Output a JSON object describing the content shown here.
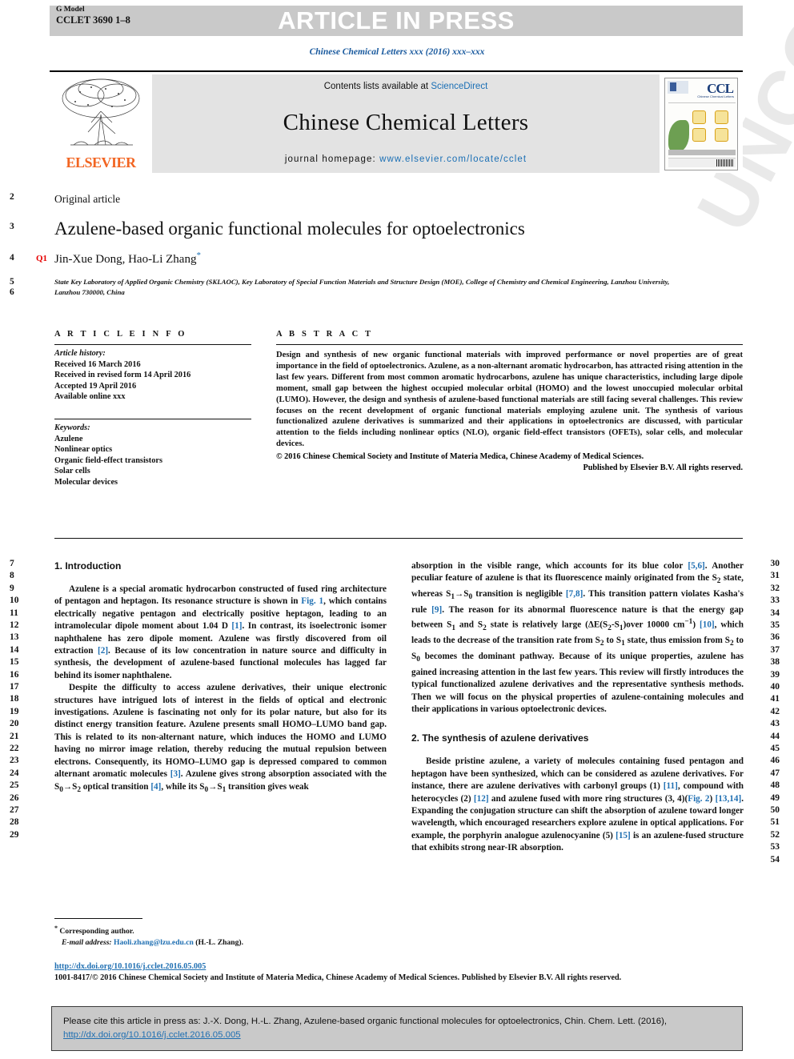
{
  "header": {
    "g_model": "G Model",
    "article_code": "CCLET 3690 1–8",
    "article_in_press": "ARTICLE IN PRESS",
    "journal_ref": "Chinese Chemical Letters xxx (2016) xxx–xxx"
  },
  "masthead": {
    "contents_prefix": "Contents lists available at ",
    "contents_link": "ScienceDirect",
    "journal_title": "Chinese Chemical Letters",
    "homepage_label": "journal homepage: ",
    "homepage_url": "www.elsevier.com/locate/cclet",
    "publisher": "ELSEVIER",
    "cover_logo": "CCL",
    "cover_subtitle": "Chinese Chemical Letters"
  },
  "article": {
    "type_label": "Original article",
    "title": "Azulene-based organic functional molecules for optoelectronics",
    "query_marker": "Q1",
    "authors": "Jin-Xue Dong, Hao-Li Zhang",
    "corresponding_mark": "*",
    "affiliation": "State Key Laboratory of Applied Organic Chemistry (SKLAOC), Key Laboratory of Special Function Materials and Structure Design (MOE), College of Chemistry and Chemical Engineering, Lanzhou University, Lanzhou 730000, China"
  },
  "info": {
    "heading": "A R T I C L E  I N F O",
    "history_label": "Article history:",
    "history": [
      "Received 16 March 2016",
      "Received in revised form 14 April 2016",
      "Accepted 19 April 2016",
      "Available online xxx"
    ],
    "keywords_label": "Keywords:",
    "keywords": [
      "Azulene",
      "Nonlinear optics",
      "Organic field-effect transistors",
      "Solar cells",
      "Molecular devices"
    ]
  },
  "abstract": {
    "heading": "A B S T R A C T",
    "text": "Design and synthesis of new organic functional materials with improved performance or novel properties are of great importance in the field of optoelectronics. Azulene, as a non-alternant aromatic hydrocarbon, has attracted rising attention in the last few years. Different from most common aromatic hydrocarbons, azulene has unique characteristics, including large dipole moment, small gap between the highest occupied molecular orbital (HOMO) and the lowest unoccupied molecular orbital (LUMO). However, the design and synthesis of azulene-based functional materials are still facing several challenges. This review focuses on the recent development of organic functional materials employing azulene unit. The synthesis of various functionalized azulene derivatives is summarized and their applications in optoelectronics are discussed, with particular attention to the fields including nonlinear optics (NLO), organic field-effect transistors (OFETs), solar cells, and molecular devices.",
    "copyright_line1": "© 2016 Chinese Chemical Society and Institute of Materia Medica, Chinese Academy of Medical Sciences.",
    "copyright_line2": "Published by Elsevier B.V. All rights reserved."
  },
  "body": {
    "section1_heading": "1. Introduction",
    "section1_p1_parts": [
      "Azulene is a special aromatic hydrocarbon constructed of fused ring architecture of pentagon and heptagon. Its resonance structure is shown in ",
      "Fig. 1",
      ", which contains electrically negative pentagon and electrically positive heptagon, leading to an intramolecular dipole moment about 1.04 D ",
      "[1]",
      ". In contrast, its isoelectronic isomer naphthalene has zero dipole moment. Azulene was firstly discovered from oil extraction ",
      "[2]",
      ". Because of its low concentration in nature source and difficulty in synthesis, the development of azulene-based functional molecules has lagged far behind its isomer naphthalene."
    ],
    "section1_p2_parts": [
      "Despite the difficulty to access azulene derivatives, their unique electronic structures have intrigued lots of interest in the fields of optical and electronic investigations. Azulene is fascinating not only for its polar nature, but also for its distinct energy transition feature. Azulene presents small HOMO–LUMO band gap. This is related to its non-alternant nature, which induces the HOMO and LUMO having no mirror image relation, thereby reducing the mutual repulsion between electrons. Consequently, its HOMO–LUMO gap is depressed compared to common alternant aromatic molecules ",
      "[3]",
      ". Azulene gives strong absorption associated with the S",
      "0",
      "→S",
      "2",
      " optical transition ",
      "[4]",
      ", while its S",
      "0",
      "→S",
      "1",
      " transition gives weak"
    ],
    "section1_p3_parts": [
      "absorption in the visible range, which accounts for its blue color ",
      "[5,6]",
      ". Another peculiar feature of azulene is that its fluorescence mainly originated from the S",
      "2",
      " state, whereas S",
      "1",
      "→S",
      "0",
      " transition is negligible ",
      "[7,8]",
      ". This transition pattern violates Kasha's rule ",
      "[9]",
      ". The reason for its abnormal fluorescence nature is that the energy gap between S",
      "1",
      " and S",
      "2",
      " state is relatively large (ΔE(S",
      "2",
      "-S",
      "1",
      ")over 10000 cm",
      "−1",
      ") ",
      "[10]",
      ", which leads to the decrease of the transition rate from S",
      "2",
      " to S",
      "1",
      " state, thus emission from S",
      "2",
      " to S",
      "0",
      " becomes the dominant pathway. Because of its unique properties, azulene has gained increasing attention in the last few years. This review will firstly introduces the typical functionalized azulene derivatives and the representative synthesis methods. Then we will focus on the physical properties of azulene-containing molecules and their applications in various optoelectronic devices."
    ],
    "section2_heading": "2. The synthesis of azulene derivatives",
    "section2_p1_parts": [
      "Beside pristine azulene, a variety of molecules containing fused pentagon and heptagon have been synthesized, which can be considered as azulene derivatives. For instance, there are azulene derivatives with carbonyl groups (1) ",
      "[11]",
      ", compound with heterocycles (2) ",
      "[12]",
      " and azulene fused with more ring structures (3, 4)(",
      "Fig. 2",
      ") ",
      "[13,14]",
      ". Expanding the conjugation structure can shift the absorption of azulene toward longer wavelength, which encouraged researchers explore azulene in optical applications. For example, the porphyrin analogue azulenocyanine (5) ",
      "[15]",
      " is an azulene-fused structure that exhibits strong near-IR absorption."
    ]
  },
  "footnote": {
    "corresponding_mark": "*",
    "corresponding_label": "Corresponding author.",
    "email_label": "E-mail address:",
    "email": "Haoli.zhang@lzu.edu.cn",
    "email_suffix": "(H.-L. Zhang).",
    "doi_link": "http://dx.doi.org/10.1016/j.cclet.2016.05.005",
    "issn_line": "1001-8417/© 2016 Chinese Chemical Society and Institute of Materia Medica, Chinese Academy of Medical Sciences. Published by Elsevier B.V. All rights reserved."
  },
  "citation": {
    "prefix": "Please cite this article in press as: J.-X. Dong, H.-L. Zhang, Azulene-based organic functional molecules for optoelectronics, Chin. Chem. Lett. (2016), ",
    "link": "http://dx.doi.org/10.1016/j.cclet.2016.05.005"
  },
  "line_numbers": {
    "head_left": [
      "2",
      "3",
      "4",
      "5",
      "6"
    ],
    "body_left": [
      "7",
      "8",
      "9",
      "10",
      "11",
      "12",
      "13",
      "14",
      "15",
      "16",
      "17",
      "18",
      "19",
      "20",
      "21",
      "22",
      "23",
      "24",
      "25",
      "26",
      "27",
      "28",
      "29"
    ],
    "body_right": [
      "30",
      "31",
      "32",
      "33",
      "34",
      "35",
      "36",
      "37",
      "38",
      "39",
      "40",
      "41",
      "42",
      "43",
      "44",
      "45",
      "46",
      "47",
      "48",
      "49",
      "50",
      "51",
      "52",
      "53",
      "54"
    ]
  },
  "watermark": {
    "text": "UNCORRECTED PROOF"
  },
  "colors": {
    "link": "#1f6fb2",
    "elsevier_orange": "#F26522",
    "query_red": "#e60000",
    "press_bar": "#c9c9c9"
  }
}
